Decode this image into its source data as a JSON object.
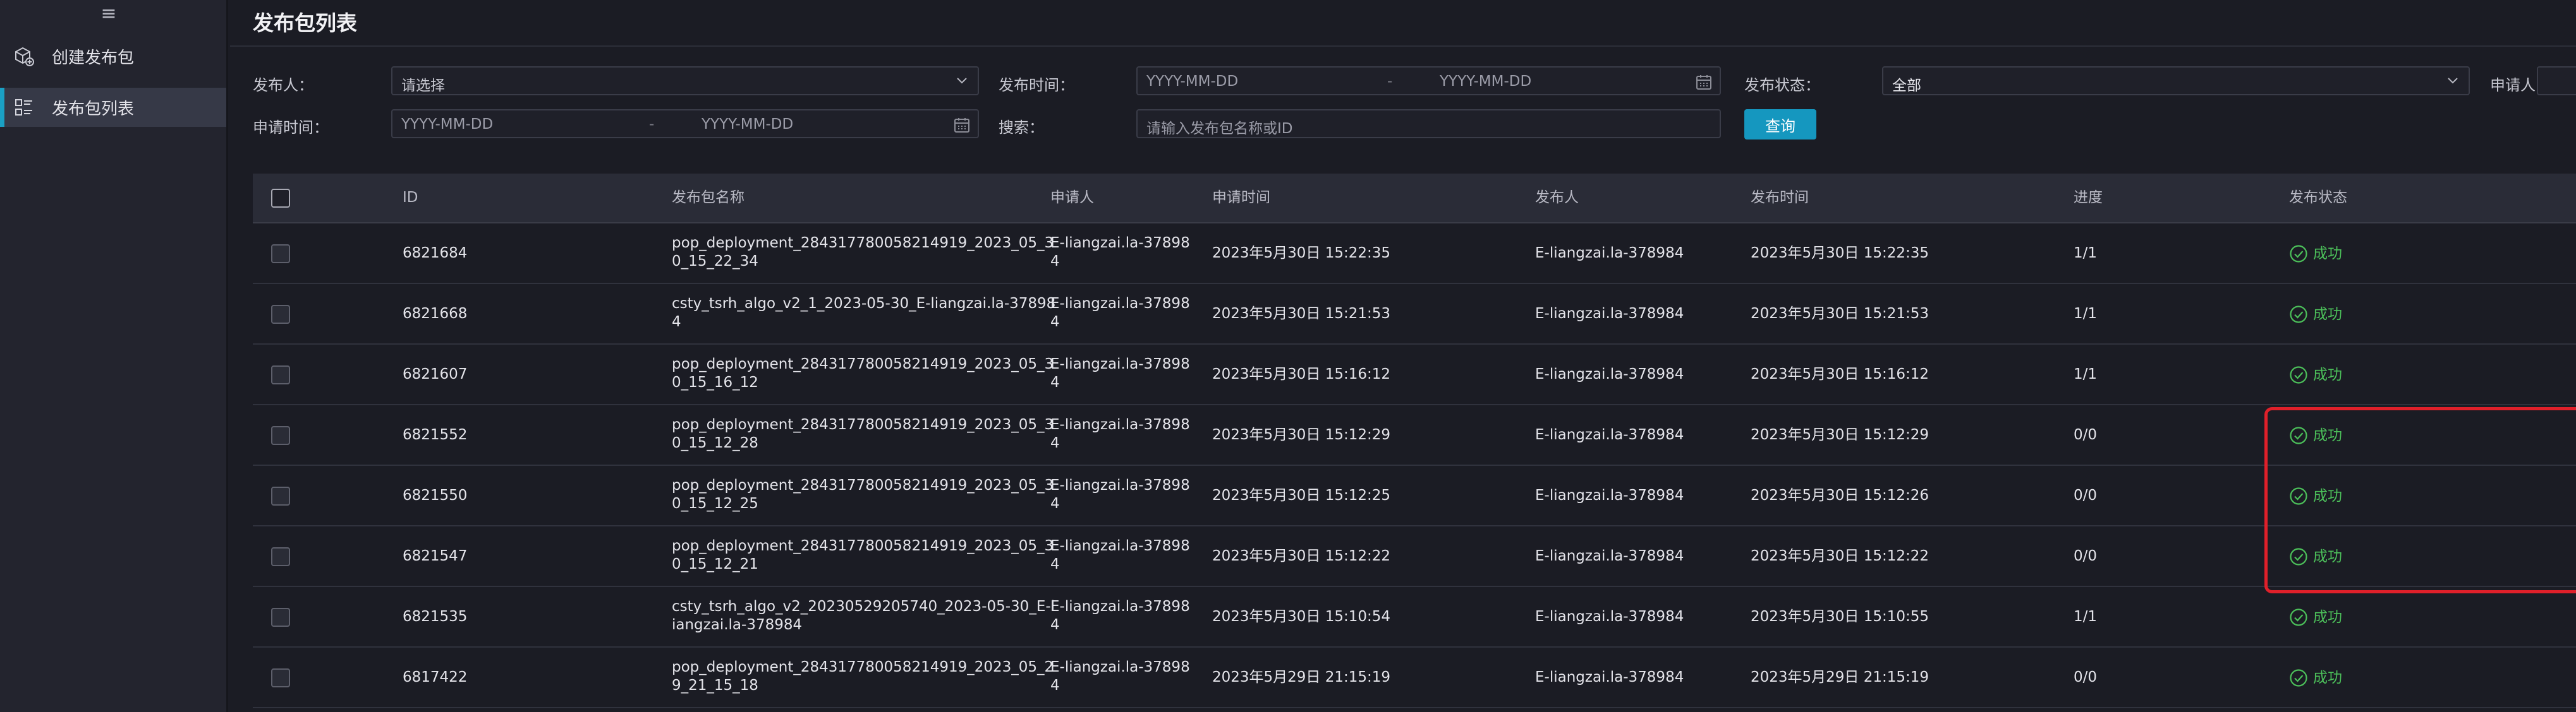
{
  "sidebar": {
    "items": [
      {
        "label": "创建发布包",
        "icon": "create-package-icon"
      },
      {
        "label": "发布包列表",
        "icon": "list-icon"
      }
    ]
  },
  "page": {
    "title": "发布包列表"
  },
  "filters": {
    "publisher_label": "发布人：",
    "publisher_placeholder": "请选择",
    "publish_time_label": "发布时间：",
    "publish_time_start": "YYYY-MM-DD",
    "publish_time_end": "YYYY-MM-DD",
    "publish_status_label": "发布状态：",
    "publish_status_value": "全部",
    "applicant_label": "申请人：",
    "apply_time_label": "申请时间：",
    "apply_time_start": "YYYY-MM-DD",
    "apply_time_end": "YYYY-MM-DD",
    "search_label": "搜索：",
    "search_placeholder": "请输入发布包名称或ID",
    "range_separator": "-",
    "query_button": "查询"
  },
  "table": {
    "columns": [
      "ID",
      "发布包名称",
      "申请人",
      "申请时间",
      "发布人",
      "发布时间",
      "进度",
      "发布状态"
    ],
    "rows": [
      {
        "id": "6821684",
        "name1": "pop_deployment_284317780058214919_2023_05_3",
        "name2": "0_15_22_34",
        "applicant1": "E-liangzai.la-37898",
        "applicant2": "4",
        "apply_time": "2023年5月30日 15:22:35",
        "publisher": "E-liangzai.la-378984",
        "publish_time": "2023年5月30日 15:22:35",
        "progress": "1/1",
        "status": "成功"
      },
      {
        "id": "6821668",
        "name1": "csty_tsrh_algo_v2_1_2023-05-30_E-liangzai.la-37898",
        "name2": "4",
        "applicant1": "E-liangzai.la-37898",
        "applicant2": "4",
        "apply_time": "2023年5月30日 15:21:53",
        "publisher": "E-liangzai.la-378984",
        "publish_time": "2023年5月30日 15:21:53",
        "progress": "1/1",
        "status": "成功"
      },
      {
        "id": "6821607",
        "name1": "pop_deployment_284317780058214919_2023_05_3",
        "name2": "0_15_16_12",
        "applicant1": "E-liangzai.la-37898",
        "applicant2": "4",
        "apply_time": "2023年5月30日 15:16:12",
        "publisher": "E-liangzai.la-378984",
        "publish_time": "2023年5月30日 15:16:12",
        "progress": "1/1",
        "status": "成功"
      },
      {
        "id": "6821552",
        "name1": "pop_deployment_284317780058214919_2023_05_3",
        "name2": "0_15_12_28",
        "applicant1": "E-liangzai.la-37898",
        "applicant2": "4",
        "apply_time": "2023年5月30日 15:12:29",
        "publisher": "E-liangzai.la-378984",
        "publish_time": "2023年5月30日 15:12:29",
        "progress": "0/0",
        "status": "成功"
      },
      {
        "id": "6821550",
        "name1": "pop_deployment_284317780058214919_2023_05_3",
        "name2": "0_15_12_25",
        "applicant1": "E-liangzai.la-37898",
        "applicant2": "4",
        "apply_time": "2023年5月30日 15:12:25",
        "publisher": "E-liangzai.la-378984",
        "publish_time": "2023年5月30日 15:12:26",
        "progress": "0/0",
        "status": "成功"
      },
      {
        "id": "6821547",
        "name1": "pop_deployment_284317780058214919_2023_05_3",
        "name2": "0_15_12_21",
        "applicant1": "E-liangzai.la-37898",
        "applicant2": "4",
        "apply_time": "2023年5月30日 15:12:22",
        "publisher": "E-liangzai.la-378984",
        "publish_time": "2023年5月30日 15:12:22",
        "progress": "0/0",
        "status": "成功"
      },
      {
        "id": "6821535",
        "name1": "csty_tsrh_algo_v2_20230529205740_2023-05-30_E-l",
        "name2": "iangzai.la-378984",
        "applicant1": "E-liangzai.la-37898",
        "applicant2": "4",
        "apply_time": "2023年5月30日 15:10:54",
        "publisher": "E-liangzai.la-378984",
        "publish_time": "2023年5月30日 15:10:55",
        "progress": "1/1",
        "status": "成功"
      },
      {
        "id": "6817422",
        "name1": "pop_deployment_284317780058214919_2023_05_2",
        "name2": "9_21_15_18",
        "applicant1": "E-liangzai.la-37898",
        "applicant2": "4",
        "apply_time": "2023年5月29日 21:15:19",
        "publisher": "E-liangzai.la-378984",
        "publish_time": "2023年5月29日 21:15:19",
        "progress": "0/0",
        "status": "成功"
      }
    ]
  },
  "colors": {
    "accent": "#1597bf",
    "success": "#4cc05a",
    "highlight": "#e0202a"
  }
}
